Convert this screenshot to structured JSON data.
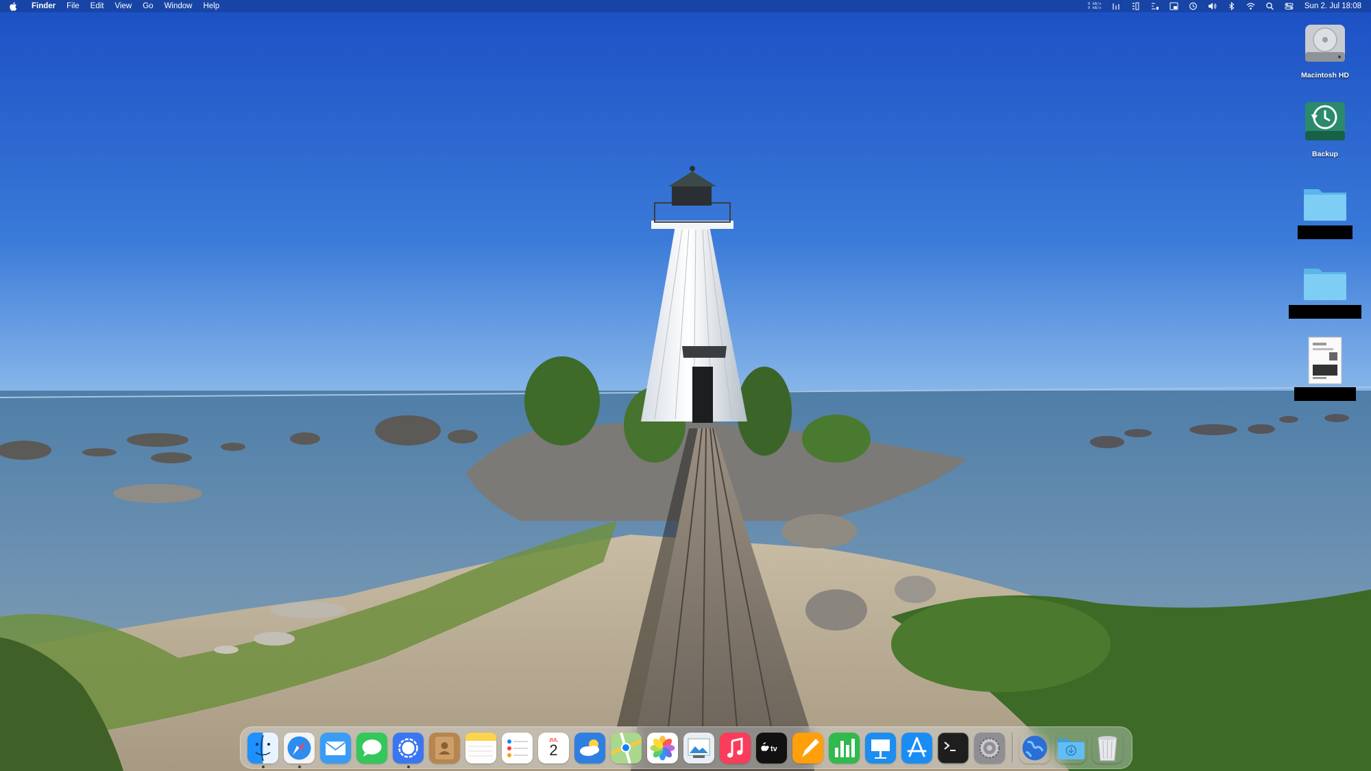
{
  "menubar": {
    "app_name": "Finder",
    "menus": [
      "File",
      "Edit",
      "View",
      "Go",
      "Window",
      "Help"
    ],
    "net_stats": "0 kB/s\n0 kB/s",
    "status_icons": [
      "bar-chart-icon",
      "memory-icon",
      "cpu-icon",
      "window-layout-icon",
      "time-machine-icon",
      "volume-icon",
      "bluetooth-icon",
      "wifi-icon",
      "spotlight-search-icon",
      "control-center-icon"
    ],
    "clock": "Sun 2. Jul  18:08"
  },
  "desktop": {
    "icons": [
      {
        "name": "Macintosh HD",
        "kind": "hard-drive"
      },
      {
        "name": "Backup",
        "kind": "time-machine-drive"
      },
      {
        "name": "",
        "kind": "folder",
        "redacted": true
      },
      {
        "name": "",
        "kind": "folder",
        "redacted": true
      },
      {
        "name": "",
        "kind": "document",
        "redacted": true
      }
    ]
  },
  "calendar": {
    "month": "JUL",
    "day": "2"
  },
  "dock": {
    "apps": [
      "Finder",
      "Safari",
      "Mail",
      "Messages",
      "Signal",
      "Contacts",
      "Notes",
      "Reminders",
      "Calendar",
      "Weather",
      "Maps",
      "Photos",
      "Preview",
      "Music",
      "TV",
      "Pages",
      "Numbers",
      "Keynote",
      "App Store",
      "Terminal",
      "System Settings"
    ],
    "others": [
      "Browser",
      "Downloads",
      "Trash"
    ]
  },
  "colors": {
    "sky_top": "#1f55c8",
    "sky_horizon": "#7fb0e8",
    "sea": "#5c85a8",
    "menubar": "#1a3f8c"
  }
}
